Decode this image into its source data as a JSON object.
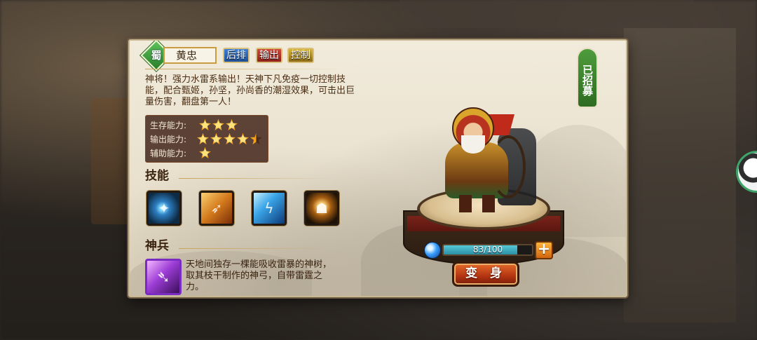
{
  "hero": {
    "faction": "蜀",
    "name": "黄忠",
    "tags": [
      {
        "label": "后排",
        "color": "#2f6bc2"
      },
      {
        "label": "输出",
        "color": "#b02a1e"
      },
      {
        "label": "控制",
        "color": "#c49a24"
      }
    ],
    "description": "神将！强力水雷系输出！天神下凡免疫一切控制技能，配合甄姬，孙坚，孙尚香的潮湿效果，可击出巨量伤害，翻盘第一人！",
    "recruited_label": "已招募"
  },
  "abilities": [
    {
      "label": "生存能力:",
      "stars": 3
    },
    {
      "label": "输出能力:",
      "stars": 4.5
    },
    {
      "label": "辅助能力:",
      "stars": 1
    }
  ],
  "skills_section": {
    "title": "技能",
    "skills": [
      {
        "icon": "shadow-warrior-skill-icon"
      },
      {
        "icon": "arrow-strike-skill-icon"
      },
      {
        "icon": "ice-lightning-skill-icon"
      },
      {
        "icon": "dark-summon-skill-icon"
      }
    ]
  },
  "weapon_section": {
    "title": "神兵",
    "icon": "divine-bow-icon",
    "description": "天地间独存一棵能吸收雷暴的神树，取其枝干制作的神弓，自带雷霆之力。"
  },
  "progress": {
    "current": 83,
    "max": 100,
    "text": "83/100",
    "plus_label": "+"
  },
  "transform_button": "变 身",
  "colors": {
    "panel_bg": "#ede6d4",
    "accent_gold": "#c99d3f",
    "progress_fill": "#3fb0c2",
    "button_orange": "#c24a1c",
    "recruited_green": "#3e8a30"
  }
}
